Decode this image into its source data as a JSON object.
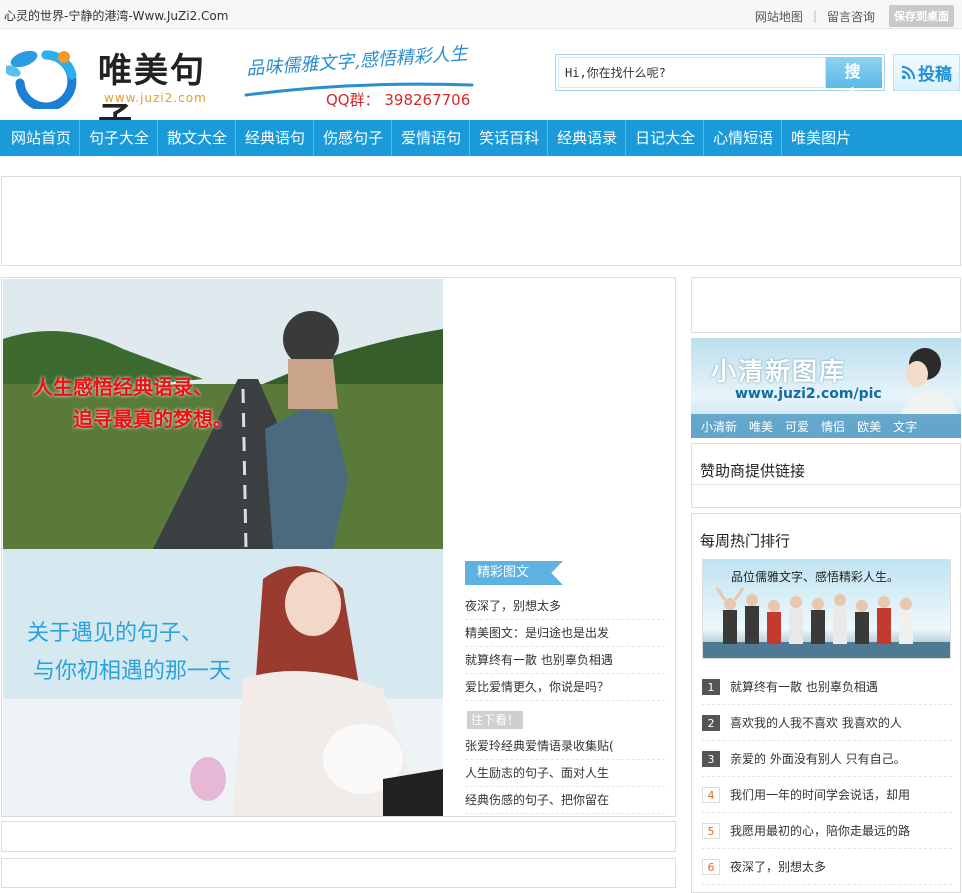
{
  "topbar": {
    "slogan": "心灵的世界-宁静的港湾-Www.JuZi2.Com",
    "sitemap": "网站地图",
    "sep": "|",
    "guestbook": "留言咨询",
    "save_desktop": "保存到桌面"
  },
  "header": {
    "logo_title": "唯美句子",
    "logo_url": "www.juzi2.com",
    "tagline": "品味儒雅文字,感悟精彩人生",
    "qq": "QQ群： 398267706",
    "search_value": "Hi,你在找什么呢?",
    "search_button": "搜 索",
    "submit_button": "投稿"
  },
  "nav": [
    "网站首页",
    "句子大全",
    "散文大全",
    "经典语句",
    "伤感句子",
    "爱情语句",
    "笑话百科",
    "经典语录",
    "日记大全",
    "心情短语",
    "唯美图片"
  ],
  "slides": [
    {
      "caption_line1": "人生感悟经典语录、",
      "caption_line2": "追寻最真的梦想。"
    },
    {
      "caption_line1": "关于遇见的句子、",
      "caption_line2": "与你初相遇的那一天"
    }
  ],
  "picks": {
    "tag": "精彩图文",
    "items": [
      "夜深了，别想太多",
      "精美图文：是归途也是出发",
      "就算终有一散 也别辜负相遇",
      "爱比爱情更久，你说是吗？"
    ]
  },
  "more": {
    "tag": "往下看！",
    "items": [
      "张爱玲经典爱情语录收集贴(",
      "人生励志的句子、面对人生",
      "经典伤感的句子、把你留在"
    ]
  },
  "pic_banner": {
    "title": "小清新图库",
    "url": "www.juzi2.com/pic",
    "tags": [
      "小清新",
      "唯美",
      "可爱",
      "情侣",
      "欧美",
      "文字"
    ]
  },
  "sponsor": {
    "title": "赞助商提供链接"
  },
  "weekly": {
    "title": "每周热门排行",
    "image_caption": "品位儒雅文字、感悟精彩人生。",
    "items": [
      {
        "num": "1",
        "text": "就算终有一散 也别辜负相遇"
      },
      {
        "num": "2",
        "text": "喜欢我的人我不喜欢 我喜欢的人"
      },
      {
        "num": "3",
        "text": "亲爱的 外面没有别人 只有自己。"
      },
      {
        "num": "4",
        "text": "我们用一年的时间学会说话，却用"
      },
      {
        "num": "5",
        "text": "我愿用最初的心，陪你走最远的路"
      },
      {
        "num": "6",
        "text": "夜深了，别想太多"
      }
    ]
  },
  "colors": {
    "nav_bg": "#1b9ad9",
    "accent": "#2a8fcf",
    "qq_red": "#d42a2a",
    "logo_orange": "#e69b2e"
  }
}
